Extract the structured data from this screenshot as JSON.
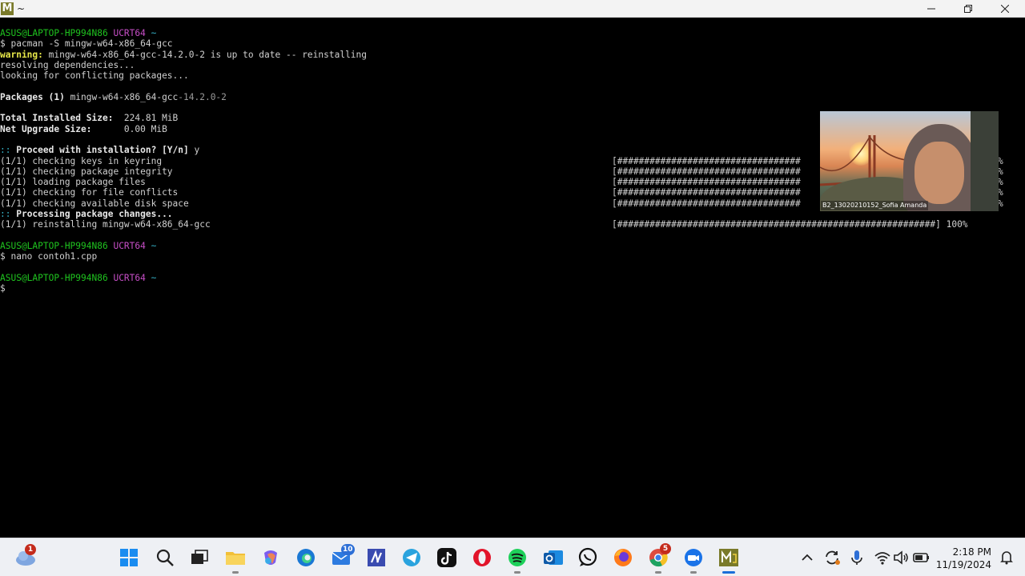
{
  "window": {
    "title": "~",
    "app_icon_letter": "M"
  },
  "terminal": {
    "lines": [
      {
        "segments": [
          {
            "cls": "green",
            "text": "ASUS@LAPTOP-HP994N86 "
          },
          {
            "cls": "magenta",
            "text": "UCRT64 "
          },
          {
            "cls": "cyan",
            "text": "~"
          }
        ]
      },
      {
        "segments": [
          {
            "cls": "",
            "text": "$ pacman -S mingw-w64-x86_64-gcc"
          }
        ]
      },
      {
        "segments": [
          {
            "cls": "yellow",
            "text": "warning:"
          },
          {
            "cls": "",
            "text": " mingw-w64-x86_64-gcc-14.2.0-2 is up to date -- reinstalling"
          }
        ]
      },
      {
        "segments": [
          {
            "cls": "",
            "text": "resolving dependencies..."
          }
        ]
      },
      {
        "segments": [
          {
            "cls": "",
            "text": "looking for conflicting packages..."
          }
        ]
      },
      {
        "segments": []
      },
      {
        "segments": [
          {
            "cls": "bold",
            "text": "Packages (1)"
          },
          {
            "cls": "",
            "text": " mingw-w64-x86_64-gcc"
          },
          {
            "cls": "dim",
            "text": "-14.2.0-2"
          }
        ]
      },
      {
        "segments": []
      },
      {
        "segments": [
          {
            "cls": "bold",
            "text": "Total Installed Size:"
          },
          {
            "cls": "",
            "text": "  224.81 MiB"
          }
        ]
      },
      {
        "segments": [
          {
            "cls": "bold",
            "text": "Net Upgrade Size:"
          },
          {
            "cls": "",
            "text": "      0.00 MiB"
          }
        ]
      },
      {
        "segments": []
      },
      {
        "segments": [
          {
            "cls": "cyan",
            "text": "::"
          },
          {
            "cls": "bold",
            "text": " Proceed with installation? [Y/n]"
          },
          {
            "cls": "",
            "text": " y"
          }
        ]
      },
      {
        "segments": [
          {
            "cls": "",
            "text": "(1/1) checking keys in keyring"
          }
        ],
        "progress": "[##################################",
        "pct": "%"
      },
      {
        "segments": [
          {
            "cls": "",
            "text": "(1/1) checking package integrity"
          }
        ],
        "progress": "[##################################",
        "pct": "%"
      },
      {
        "segments": [
          {
            "cls": "",
            "text": "(1/1) loading package files"
          }
        ],
        "progress": "[##################################",
        "pct": "%"
      },
      {
        "segments": [
          {
            "cls": "",
            "text": "(1/1) checking for file conflicts"
          }
        ],
        "progress": "[##################################",
        "pct": "%"
      },
      {
        "segments": [
          {
            "cls": "",
            "text": "(1/1) checking available disk space"
          }
        ],
        "progress": "[##################################",
        "pct": "%"
      },
      {
        "segments": [
          {
            "cls": "cyan",
            "text": "::"
          },
          {
            "cls": "bold",
            "text": " Processing package changes..."
          }
        ]
      },
      {
        "segments": [
          {
            "cls": "",
            "text": "(1/1) reinstalling mingw-w64-x86_64-gcc"
          }
        ],
        "progress": "[###########################################################] 100%",
        "pct": ""
      },
      {
        "segments": []
      },
      {
        "segments": [
          {
            "cls": "green",
            "text": "ASUS@LAPTOP-HP994N86 "
          },
          {
            "cls": "magenta",
            "text": "UCRT64 "
          },
          {
            "cls": "cyan",
            "text": "~"
          }
        ]
      },
      {
        "segments": [
          {
            "cls": "",
            "text": "$ nano contoh1.cpp"
          }
        ]
      },
      {
        "segments": []
      },
      {
        "segments": [
          {
            "cls": "green",
            "text": "ASUS@LAPTOP-HP994N86 "
          },
          {
            "cls": "magenta",
            "text": "UCRT64 "
          },
          {
            "cls": "cyan",
            "text": "~"
          }
        ]
      },
      {
        "segments": [
          {
            "cls": "",
            "text": "$"
          }
        ]
      }
    ]
  },
  "video_overlay": {
    "participant_name": "B2_13020210152_Sofia Amanda"
  },
  "taskbar": {
    "weather_badge": "1",
    "mail_badge": "10",
    "chrome_badge": "5",
    "time": "2:18 PM",
    "date": "11/19/2024",
    "apps": [
      "start",
      "search",
      "task-view",
      "file-explorer",
      "copilot",
      "edge",
      "mail",
      "visual-studio",
      "telegram",
      "tiktok",
      "opera",
      "spotify",
      "outlook",
      "whatsapp",
      "firefox",
      "chrome",
      "zoom",
      "msys2"
    ]
  },
  "colors": {
    "prompt_user": "#1fc41f",
    "prompt_env": "#c84fc8",
    "warning": "#e8e84a",
    "accent": "#1a6ed8"
  }
}
